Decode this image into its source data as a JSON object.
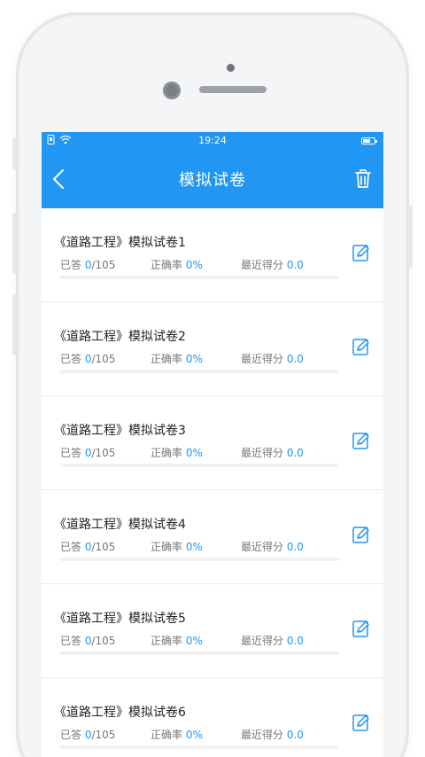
{
  "status_bar": {
    "time": "19:24",
    "battery_level": 0.7
  },
  "header": {
    "title": "模拟试卷"
  },
  "labels": {
    "answered": "已答",
    "accuracy": "正确率",
    "recent_score": "最近得分",
    "slash": "/"
  },
  "papers": [
    {
      "title": "《道路工程》模拟试卷1",
      "answered": "0",
      "total": "105",
      "accuracy": "0%",
      "score": "0.0",
      "progress": 0
    },
    {
      "title": "《道路工程》模拟试卷2",
      "answered": "0",
      "total": "105",
      "accuracy": "0%",
      "score": "0.0",
      "progress": 0
    },
    {
      "title": "《道路工程》模拟试卷3",
      "answered": "0",
      "total": "105",
      "accuracy": "0%",
      "score": "0.0",
      "progress": 0
    },
    {
      "title": "《道路工程》模拟试卷4",
      "answered": "0",
      "total": "105",
      "accuracy": "0%",
      "score": "0.0",
      "progress": 0
    },
    {
      "title": "《道路工程》模拟试卷5",
      "answered": "0",
      "total": "105",
      "accuracy": "0%",
      "score": "0.0",
      "progress": 0
    },
    {
      "title": "《道路工程》模拟试卷6",
      "answered": "0",
      "total": "105",
      "accuracy": "0%",
      "score": "0.0",
      "progress": 0
    }
  ],
  "colors": {
    "primary": "#2196f3",
    "text": "#222222",
    "muted": "#777777"
  },
  "icons": {
    "back": "chevron-left-icon",
    "delete": "trash-icon",
    "edit": "edit-icon",
    "wifi": "wifi-icon",
    "sim": "sim-icon",
    "battery": "battery-icon"
  }
}
